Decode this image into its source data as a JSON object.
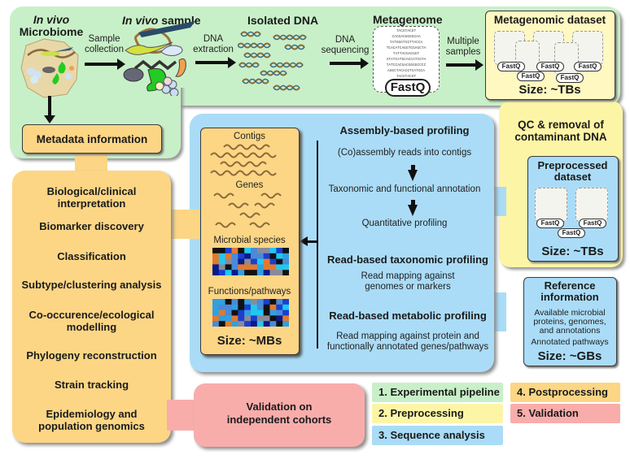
{
  "experimental_pipeline": {
    "microbiome": {
      "title_italic": "In vivo",
      "title": "Microbiome"
    },
    "sample": {
      "title_italic": "In vivo",
      "title": "sample"
    },
    "isolated_dna": {
      "title": "Isolated DNA"
    },
    "metagenome": {
      "title": "Metagenome",
      "sequences": [
        "TACGTACGT",
        "CACGACGGGGCAA",
        "TATGGGTCGTTACCA",
        "TCACATCAGGTCGAGCTA",
        "TATTACGACGGT",
        "ATATCATGCACCATCGTA",
        "TATCCACGACGGGGCCCC",
        "AGGCTACACGTCATGCA",
        "TACGTACGT"
      ],
      "format": "FastQ"
    },
    "arrows": {
      "sample_collection": [
        "Sample",
        "collection"
      ],
      "dna_extraction": [
        "DNA",
        "extraction"
      ],
      "dna_sequencing": [
        "DNA",
        "sequencing"
      ],
      "multiple_samples": [
        "Multiple",
        "samples"
      ]
    },
    "dataset": {
      "title": "Metagenomic dataset",
      "files": [
        "FastQ",
        "FastQ",
        "FastQ",
        "FastQ",
        "FastQ"
      ],
      "size": "Size: ~TBs"
    },
    "metadata": {
      "label": "Metadata information"
    }
  },
  "preprocessing": {
    "title": [
      "QC & removal of",
      "contaminant DNA"
    ],
    "dataset": {
      "title": [
        "Preprocessed",
        "dataset"
      ],
      "files": [
        "FastQ",
        "FastQ",
        "FastQ"
      ],
      "size": "Size: ~TBs"
    }
  },
  "sequence_analysis": {
    "assembly": {
      "title": "Assembly-based profiling",
      "steps": [
        "(Co)assembly reads into contigs",
        "Taxonomic and functional annotation",
        "Quantitative profiling"
      ]
    },
    "read_taxonomic": {
      "title": "Read-based taxonomic profiling",
      "desc": [
        "Read mapping  against",
        "genomes or markers"
      ]
    },
    "read_metabolic": {
      "title": "Read-based metabolic profiling",
      "desc": [
        "Read mapping  against protein and",
        "functionally annotated genes/pathways"
      ]
    },
    "outputs": {
      "contigs": "Contigs",
      "genes": "Genes",
      "species": "Microbial species",
      "functions": "Functions/pathways",
      "size": "Size: ~MBs"
    },
    "reference": {
      "title": [
        "Reference",
        "information"
      ],
      "desc": [
        "Available microbial",
        "proteins, genomes,",
        "and annotations"
      ],
      "pathways": "Annotated pathways",
      "size": "Size: ~GBs"
    }
  },
  "postprocessing": {
    "items": [
      [
        "Biological/clinical",
        "interpretation"
      ],
      [
        "Biomarker discovery"
      ],
      [
        "Classification"
      ],
      [
        "Subtype/clustering analysis"
      ],
      [
        "Co-occurence/ecological",
        "modelling"
      ],
      [
        "Phylogeny reconstruction"
      ],
      [
        "Strain tracking"
      ],
      [
        "Epidemiology and",
        "population genomics"
      ]
    ]
  },
  "validation": {
    "label": [
      "Validation on",
      "independent cohorts"
    ]
  },
  "legend": [
    {
      "label": "1. Experimental pipeline",
      "color": "#c8f0c8"
    },
    {
      "label": "2. Preprocessing",
      "color": "#fdf5a6"
    },
    {
      "label": "3. Sequence analysis",
      "color": "#aadcf7"
    },
    {
      "label": "4. Postprocessing",
      "color": "#fcd685"
    },
    {
      "label": "5. Validation",
      "color": "#f8adab"
    }
  ],
  "colors": {
    "experimental": "#c8f0c8",
    "preprocessing": "#fdf5a6",
    "sequence": "#aadcf7",
    "postprocessing": "#fcd685",
    "validation": "#f8adab"
  }
}
